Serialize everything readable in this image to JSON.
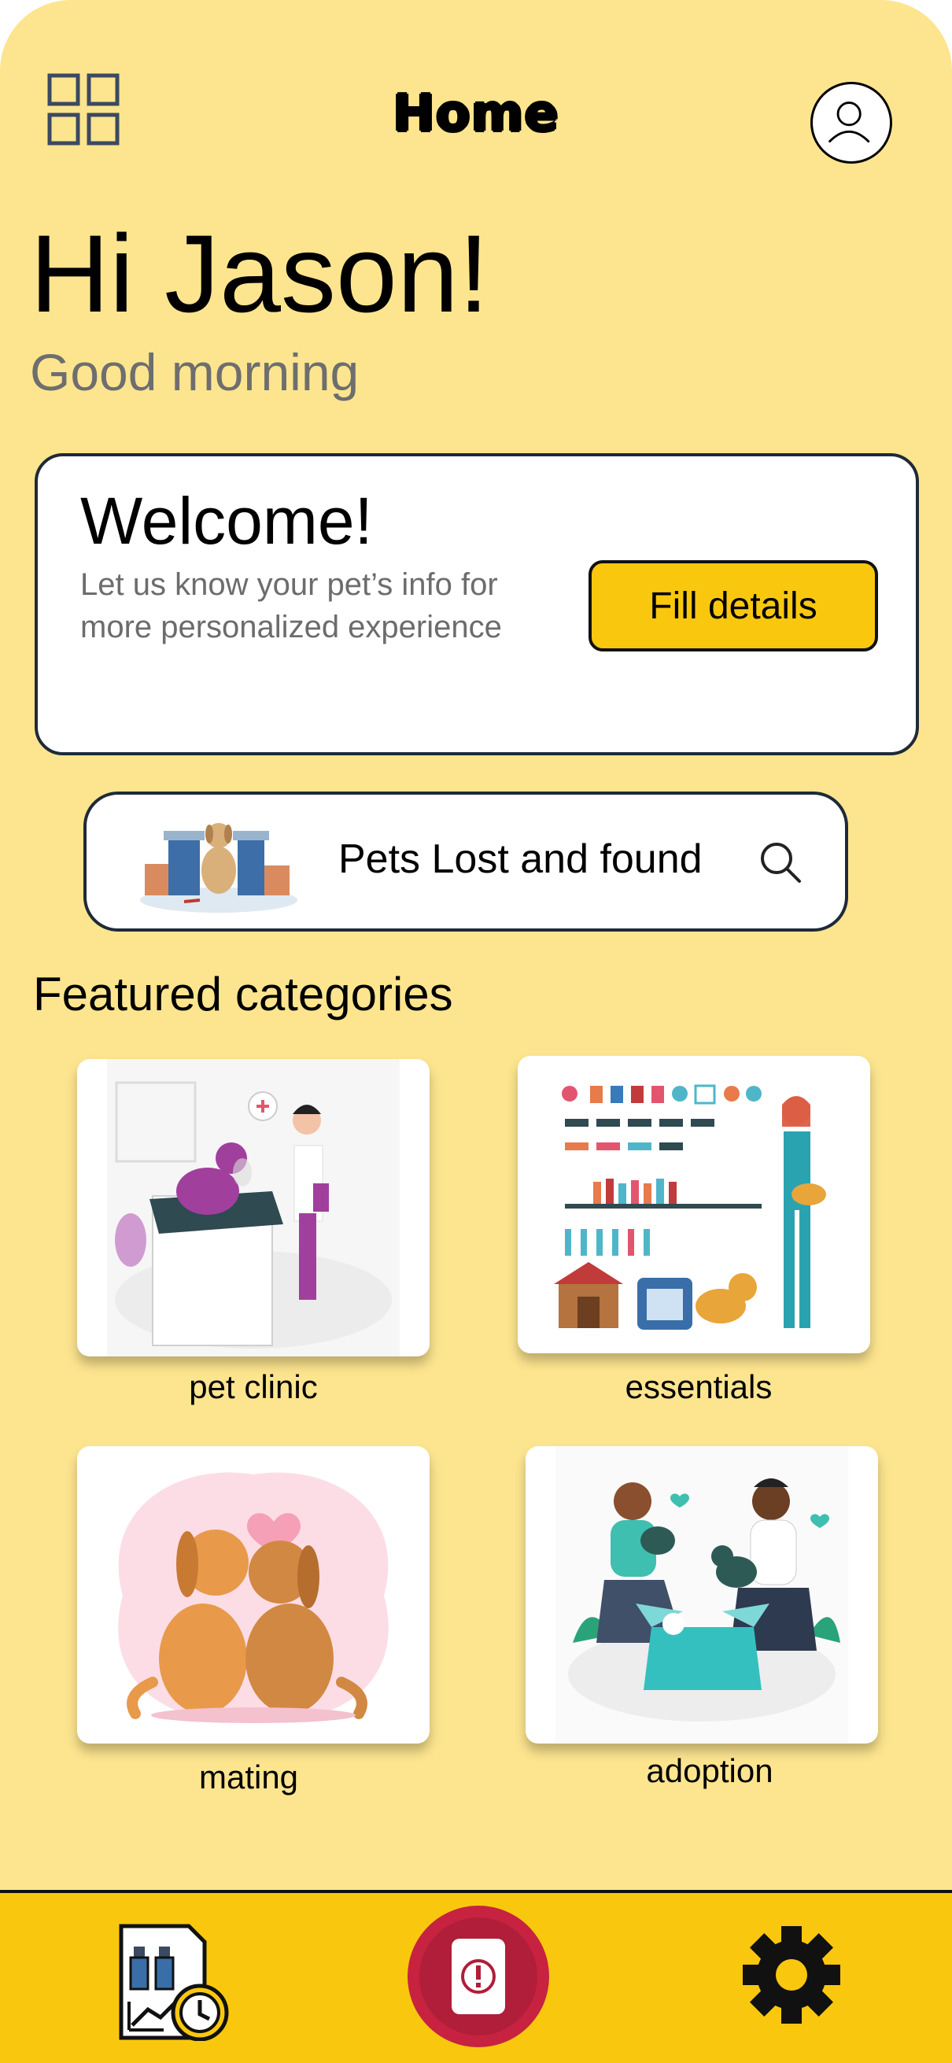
{
  "header": {
    "title": "Home",
    "menu_icon": "grid-icon",
    "profile_icon": "user-icon"
  },
  "greeting": {
    "hello": "Hi Jason!",
    "sub": "Good morning"
  },
  "welcome_card": {
    "title": "Welcome!",
    "text": "Let us know your pet’s info for more personalized experience",
    "button_label": "Fill details"
  },
  "lost_found": {
    "label": "Pets Lost and found",
    "icon": "search-icon"
  },
  "featured": {
    "title": "Featured categories",
    "items": [
      {
        "label": "pet clinic"
      },
      {
        "label": "essentials"
      },
      {
        "label": "mating"
      },
      {
        "label": "adoption"
      }
    ]
  },
  "bottom_nav": {
    "items": [
      {
        "icon": "medical-records-icon"
      },
      {
        "icon": "emergency-alert-icon"
      },
      {
        "icon": "gear-icon"
      }
    ]
  },
  "colors": {
    "background": "#FDE58F",
    "accent": "#F9C80E",
    "sos": "#C72240",
    "card_border": "#1f2a38"
  }
}
